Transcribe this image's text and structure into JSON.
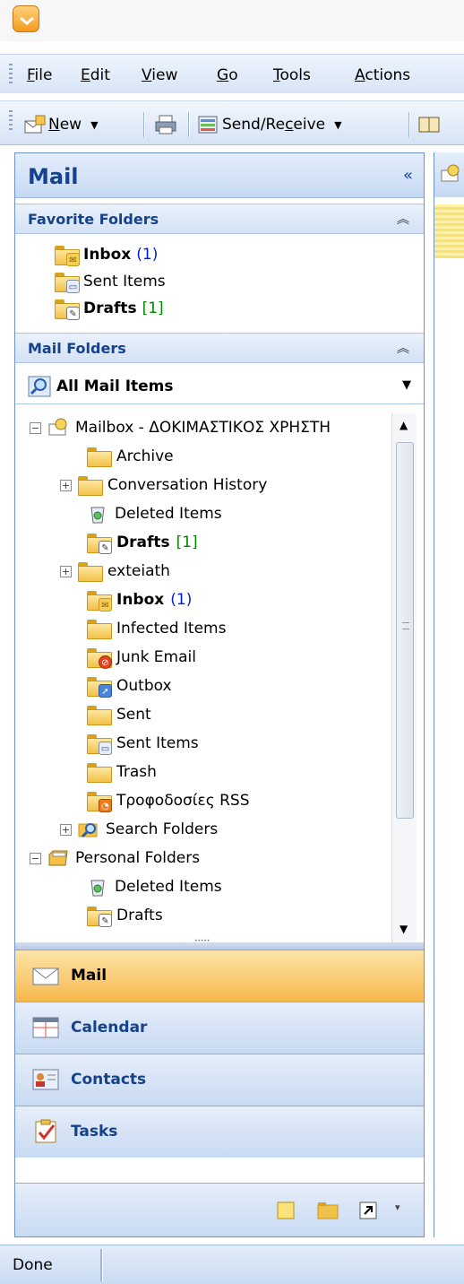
{
  "menu": {
    "items": [
      {
        "pre": "",
        "key": "F",
        "post": "ile"
      },
      {
        "pre": "",
        "key": "E",
        "post": "dit"
      },
      {
        "pre": "",
        "key": "V",
        "post": "iew"
      },
      {
        "pre": "",
        "key": "G",
        "post": "o"
      },
      {
        "pre": "",
        "key": "T",
        "post": "ools"
      },
      {
        "pre": "",
        "key": "A",
        "post": "ctions"
      }
    ]
  },
  "toolbar": {
    "new": {
      "key": "N",
      "post": "ew"
    },
    "send_receive": {
      "pre": "Send/Re",
      "key": "c",
      "post": "eive"
    }
  },
  "nav": {
    "title": "Mail",
    "collapse": "«",
    "favorites": {
      "heading": "Favorite Folders",
      "items": [
        {
          "name": "Inbox",
          "count": "(1)"
        },
        {
          "name": "Sent Items",
          "count": ""
        },
        {
          "name": "Drafts",
          "count": "[1]"
        }
      ]
    },
    "mail_folders": {
      "heading": "Mail Folders",
      "view": "All Mail Items"
    },
    "tree": [
      {
        "label": "Mailbox - ΔΟΚΙΜΑΣΤΙΚΟΣ ΧΡΗΣΤΗ",
        "count": ""
      },
      {
        "label": "Archive",
        "count": ""
      },
      {
        "label": "Conversation History",
        "count": ""
      },
      {
        "label": "Deleted Items",
        "count": ""
      },
      {
        "label": "Drafts",
        "count": "[1]"
      },
      {
        "label": "exteiath",
        "count": ""
      },
      {
        "label": "Inbox",
        "count": "(1)"
      },
      {
        "label": "Infected Items",
        "count": ""
      },
      {
        "label": "Junk Email",
        "count": ""
      },
      {
        "label": "Outbox",
        "count": ""
      },
      {
        "label": "Sent",
        "count": ""
      },
      {
        "label": "Sent Items",
        "count": ""
      },
      {
        "label": "Trash",
        "count": ""
      },
      {
        "label": "Τροφοδοσίες RSS",
        "count": ""
      },
      {
        "label": "Search Folders",
        "count": ""
      },
      {
        "label": "Personal Folders",
        "count": ""
      },
      {
        "label": "Deleted Items",
        "count": ""
      },
      {
        "label": "Drafts",
        "count": ""
      }
    ],
    "buttons": [
      {
        "label": "Mail"
      },
      {
        "label": "Calendar"
      },
      {
        "label": "Contacts"
      },
      {
        "label": "Tasks"
      }
    ]
  },
  "status": {
    "text": "Done"
  },
  "colors": {
    "accent": "#15428b",
    "active_nav": "#f7b84d",
    "count_unread": "#0022cc",
    "count_drafts": "#008800"
  }
}
